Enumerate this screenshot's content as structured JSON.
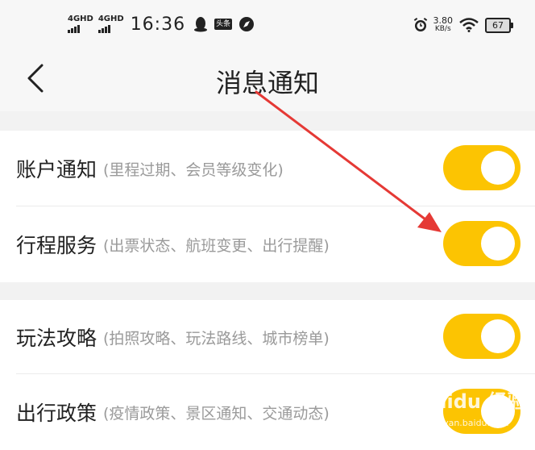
{
  "status_bar": {
    "signal_1": "4GHD",
    "signal_2": "4GHD",
    "time": "16:36",
    "toutiao_label": "头条",
    "net_speed": "3.80",
    "net_unit": "KB/s",
    "battery": "67"
  },
  "nav": {
    "title": "消息通知"
  },
  "settings": [
    {
      "title": "账户通知",
      "desc": "(里程过期、会员等级变化)",
      "enabled": true
    },
    {
      "title": "行程服务",
      "desc": "(出票状态、航班变更、出行提醒)",
      "enabled": true
    },
    {
      "title": "玩法攻略",
      "desc": "(拍照攻略、玩法路线、城市榜单)",
      "enabled": true
    },
    {
      "title": "出行政策",
      "desc": "(疫情政策、景区通知、交通动态)",
      "enabled": true
    }
  ],
  "colors": {
    "toggle_on": "#fcc402",
    "annotation_arrow": "#e53935"
  },
  "watermark": {
    "text": "Baidu 经验",
    "sub": "jingyan.baidu.com"
  }
}
